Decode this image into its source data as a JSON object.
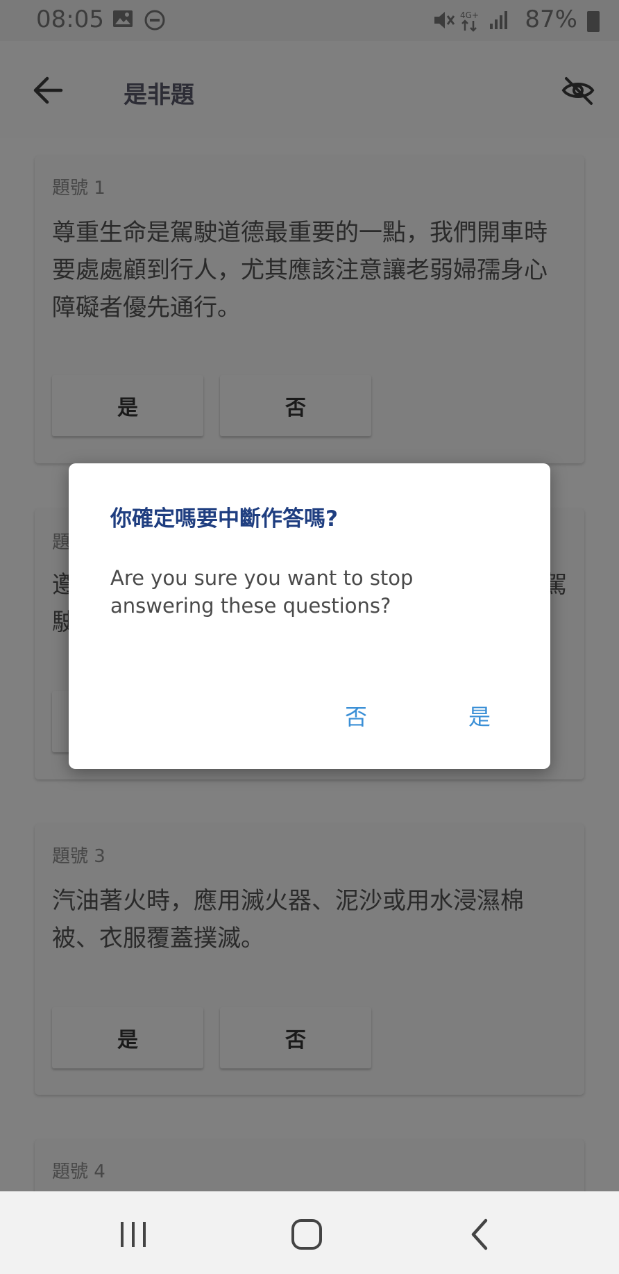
{
  "status_bar": {
    "time": "08:05",
    "battery": "87%"
  },
  "app_bar": {
    "title": "是非題"
  },
  "questions": [
    {
      "number": "題號 1",
      "text": "尊重生命是駕駛道德最重要的一點，我們開車時要處處顧到行人，尤其應該注意讓老弱婦孺身心障礙者優先通行。",
      "yes": "是",
      "no": "否"
    },
    {
      "number": "題",
      "text_line1_start": "遵",
      "text_line1_end": "駕",
      "text_line2_start": "駛"
    },
    {
      "number": "題號 3",
      "text": "汽油著火時，應用滅火器、泥沙或用水浸濕棉被、衣服覆蓋撲滅。",
      "yes": "是",
      "no": "否"
    },
    {
      "number": "題號 4"
    }
  ],
  "dialog": {
    "title": "你確定嗎要中斷作答嗎?",
    "message": "Are you sure you want to stop answering these questions?",
    "no_label": "否",
    "yes_label": "是"
  },
  "colors": {
    "dialog_title": "#1f3e80",
    "dialog_button": "#3a8fd6",
    "scrim": "#808080"
  }
}
